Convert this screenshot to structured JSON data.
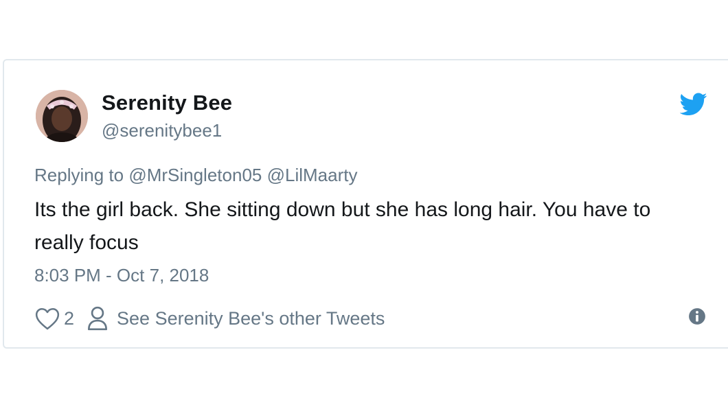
{
  "author": {
    "display_name": "Serenity Bee",
    "handle": "@serenitybee1",
    "avatar_icon": "profile-photo"
  },
  "reply": {
    "prefix": "Replying to",
    "mentions": [
      "@MrSingleton05",
      "@LilMaarty"
    ]
  },
  "tweet": {
    "text": "Its the girl back. She sitting down but she has long hair. You have to really focus",
    "timestamp": "8:03 PM - Oct 7, 2018"
  },
  "actions": {
    "like_count": "2",
    "other_tweets_label": "See Serenity Bee's other Tweets"
  },
  "icons": {
    "brand": "twitter-bird-icon",
    "like": "heart-icon",
    "profile": "person-icon",
    "info": "info-icon"
  },
  "colors": {
    "brand_blue": "#1da1f2",
    "text_primary": "#14171a",
    "text_secondary": "#657786",
    "border": "#e1e8ed"
  }
}
